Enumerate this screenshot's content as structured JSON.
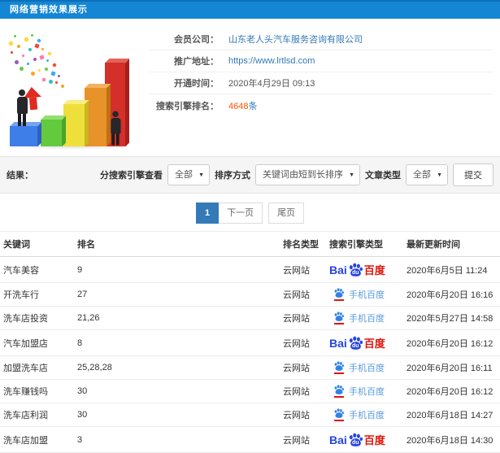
{
  "titlebar": {
    "title": "网络营销效果展示"
  },
  "info": {
    "member_label": "会员公司：",
    "member_value": "山东老人头汽车服务咨询有限公司",
    "url_label": "推广地址：",
    "url_value": "https://www.lrtlsd.com",
    "open_label": "开通时间：",
    "open_value": "2020年4月29日 09:13",
    "rank_label": "搜索引擎排名：",
    "rank_count": "4648",
    "rank_unit": "条"
  },
  "filters": {
    "result_label": "结果：",
    "engine_label": "分搜索引擎查看",
    "engine_value": "全部",
    "sort_label": "排序方式",
    "sort_value": "关键词由短到长排序",
    "article_label": "文章类型",
    "article_value": "全部",
    "submit_label": "提交",
    "caret": "▼"
  },
  "pagination": {
    "current": "1",
    "next": "下一页",
    "last": "尾页"
  },
  "table": {
    "headers": [
      "关键词",
      "排名",
      "排名类型",
      "搜索引擎类型",
      "最新更新时间"
    ],
    "engine_logos": {
      "baidu": {
        "bai": "Bai",
        "du": "du",
        "cn": "百度"
      },
      "baidu_mobile": {
        "label": "手机百度"
      }
    },
    "rows": [
      {
        "keyword": "汽车美容",
        "rank": "9",
        "rank_type": "云网站",
        "engine": "baidu",
        "updated": "2020年6月5日 11:24"
      },
      {
        "keyword": "开洗车行",
        "rank": "27",
        "rank_type": "云网站",
        "engine": "baidu_mobile",
        "updated": "2020年6月20日 16:16"
      },
      {
        "keyword": "洗车店投资",
        "rank": "21,26",
        "rank_type": "云网站",
        "engine": "baidu_mobile",
        "updated": "2020年5月27日 14:58"
      },
      {
        "keyword": "汽车加盟店",
        "rank": "8",
        "rank_type": "云网站",
        "engine": "baidu",
        "updated": "2020年6月20日 16:12"
      },
      {
        "keyword": "加盟洗车店",
        "rank": "25,28,28",
        "rank_type": "云网站",
        "engine": "baidu_mobile",
        "updated": "2020年6月20日 16:11"
      },
      {
        "keyword": "洗车赚钱吗",
        "rank": "30",
        "rank_type": "云网站",
        "engine": "baidu_mobile",
        "updated": "2020年6月20日 16:12"
      },
      {
        "keyword": "洗车店利润",
        "rank": "30",
        "rank_type": "云网站",
        "engine": "baidu_mobile",
        "updated": "2020年6月18日 14:27"
      },
      {
        "keyword": "洗车店加盟",
        "rank": "3",
        "rank_type": "云网站",
        "engine": "baidu",
        "updated": "2020年6月18日 14:30"
      }
    ]
  },
  "colors": {
    "header_blue": "#1486d3",
    "link_blue": "#337ab7",
    "highlight_orange": "#ff5102",
    "baidu_blue": "#2744e0",
    "baidu_red": "#e1140a",
    "filter_bar_bg": "#f5f5f5"
  }
}
